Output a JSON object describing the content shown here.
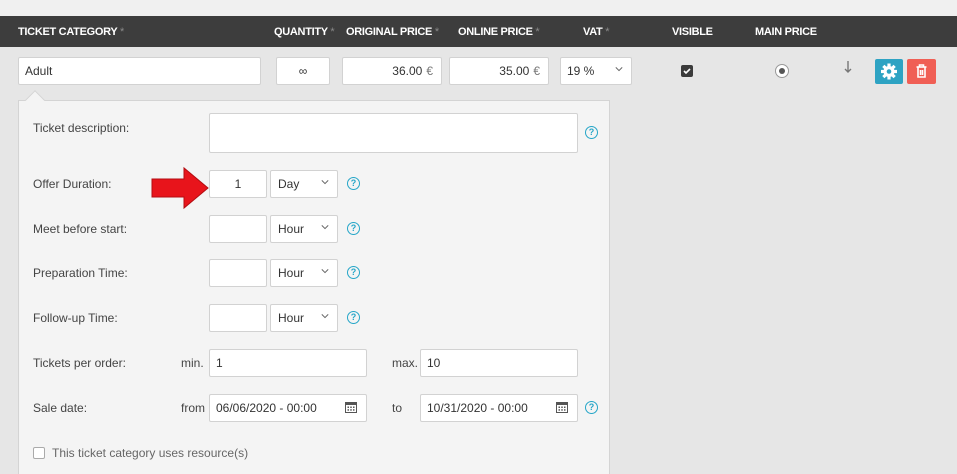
{
  "header": {
    "ticket_category": "TICKET CATEGORY",
    "quantity": "QUANTITY",
    "original_price": "ORIGINAL PRICE",
    "online_price": "ONLINE PRICE",
    "vat": "VAT",
    "visible": "VISIBLE",
    "main_price": "MAIN PRICE",
    "required_marker": "*"
  },
  "row": {
    "category_name": "Adult",
    "quantity": "∞",
    "original_price": "36.00",
    "online_price": "35.00",
    "currency": "€",
    "vat": "19 %",
    "visible_checked": true,
    "main_price_selected": true
  },
  "panel": {
    "ticket_description_label": "Ticket description:",
    "ticket_description_value": "",
    "offer_duration_label": "Offer Duration:",
    "offer_duration_value": "1",
    "offer_duration_unit": "Day",
    "meet_before_label": "Meet before start:",
    "meet_before_value": "",
    "meet_before_unit": "Hour",
    "preparation_label": "Preparation Time:",
    "preparation_value": "",
    "preparation_unit": "Hour",
    "followup_label": "Follow-up Time:",
    "followup_value": "",
    "followup_unit": "Hour",
    "tickets_per_order_label": "Tickets per order:",
    "min_label": "min.",
    "min_value": "1",
    "max_label": "max.",
    "max_value": "10",
    "sale_date_label": "Sale date:",
    "from_label": "from",
    "from_value": "06/06/2020 - 00:00",
    "to_label": "to",
    "to_value": "10/31/2020 - 00:00",
    "resource_checkbox_label": "This ticket category uses resource(s)",
    "help_glyph": "?"
  },
  "colors": {
    "header_bg": "#3d3d3d",
    "gear_button": "#2ea3c3",
    "trash_button": "#f05f55",
    "help_icon": "#26a6c8",
    "annotation_arrow": "#e8141b"
  }
}
